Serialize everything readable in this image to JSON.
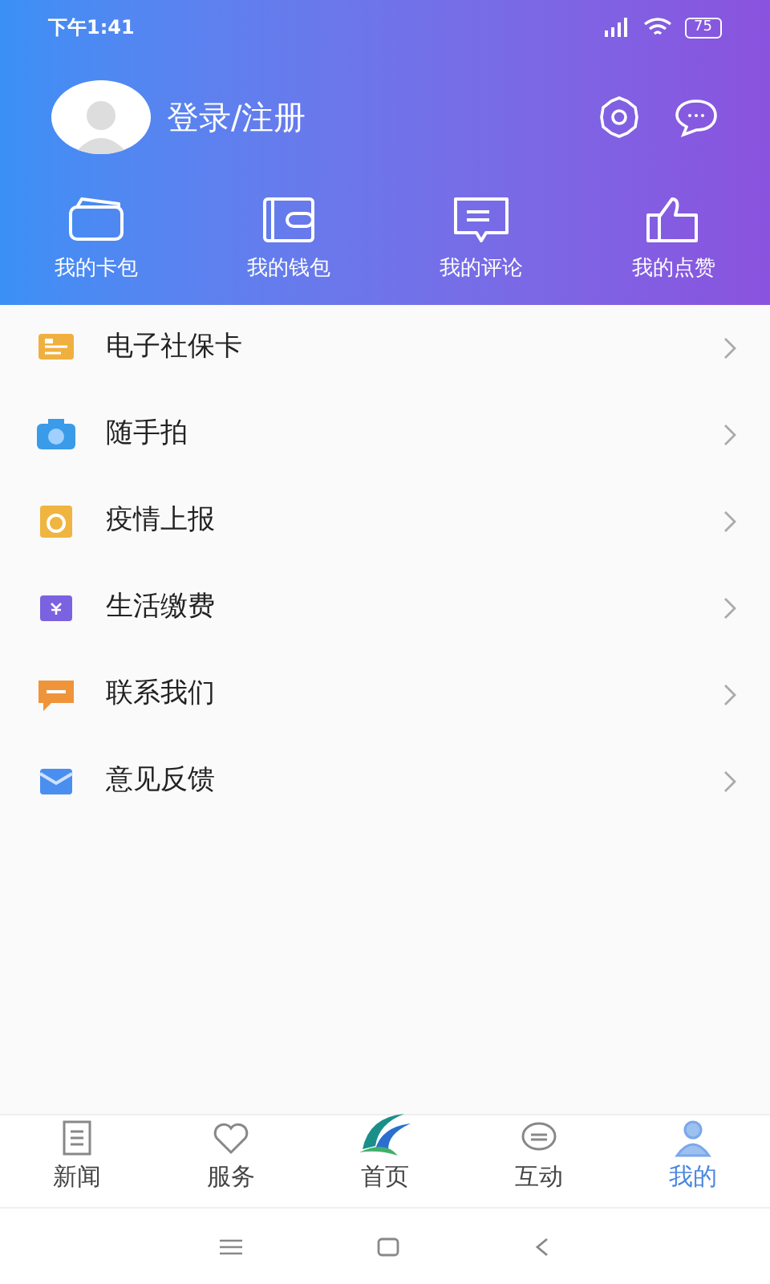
{
  "status_bar": {
    "time": "下午1:41",
    "battery": "75"
  },
  "profile": {
    "login_label": "登录/注册"
  },
  "quick_links": [
    {
      "kind": "card",
      "label": "我的卡包"
    },
    {
      "kind": "wallet",
      "label": "我的钱包"
    },
    {
      "kind": "comment",
      "label": "我的评论"
    },
    {
      "kind": "like",
      "label": "我的点赞"
    }
  ],
  "menu": [
    {
      "kind": "card",
      "label": "电子社保卡",
      "color": "#f0b040"
    },
    {
      "kind": "camera",
      "label": "随手拍",
      "color": "#3a9be8"
    },
    {
      "kind": "report",
      "label": "疫情上报",
      "color": "#f0b440"
    },
    {
      "kind": "bill",
      "label": "生活缴费",
      "color": "#7b62e0"
    },
    {
      "kind": "chat",
      "label": "联系我们",
      "color": "#f0943a"
    },
    {
      "kind": "mail",
      "label": "意见反馈",
      "color": "#4a8ff0"
    }
  ],
  "tabs": [
    {
      "kind": "news",
      "label": "新闻",
      "selected": false
    },
    {
      "kind": "service",
      "label": "服务",
      "selected": false
    },
    {
      "kind": "home",
      "label": "首页",
      "selected": false
    },
    {
      "kind": "interact",
      "label": "互动",
      "selected": false
    },
    {
      "kind": "me",
      "label": "我的",
      "selected": true
    }
  ]
}
